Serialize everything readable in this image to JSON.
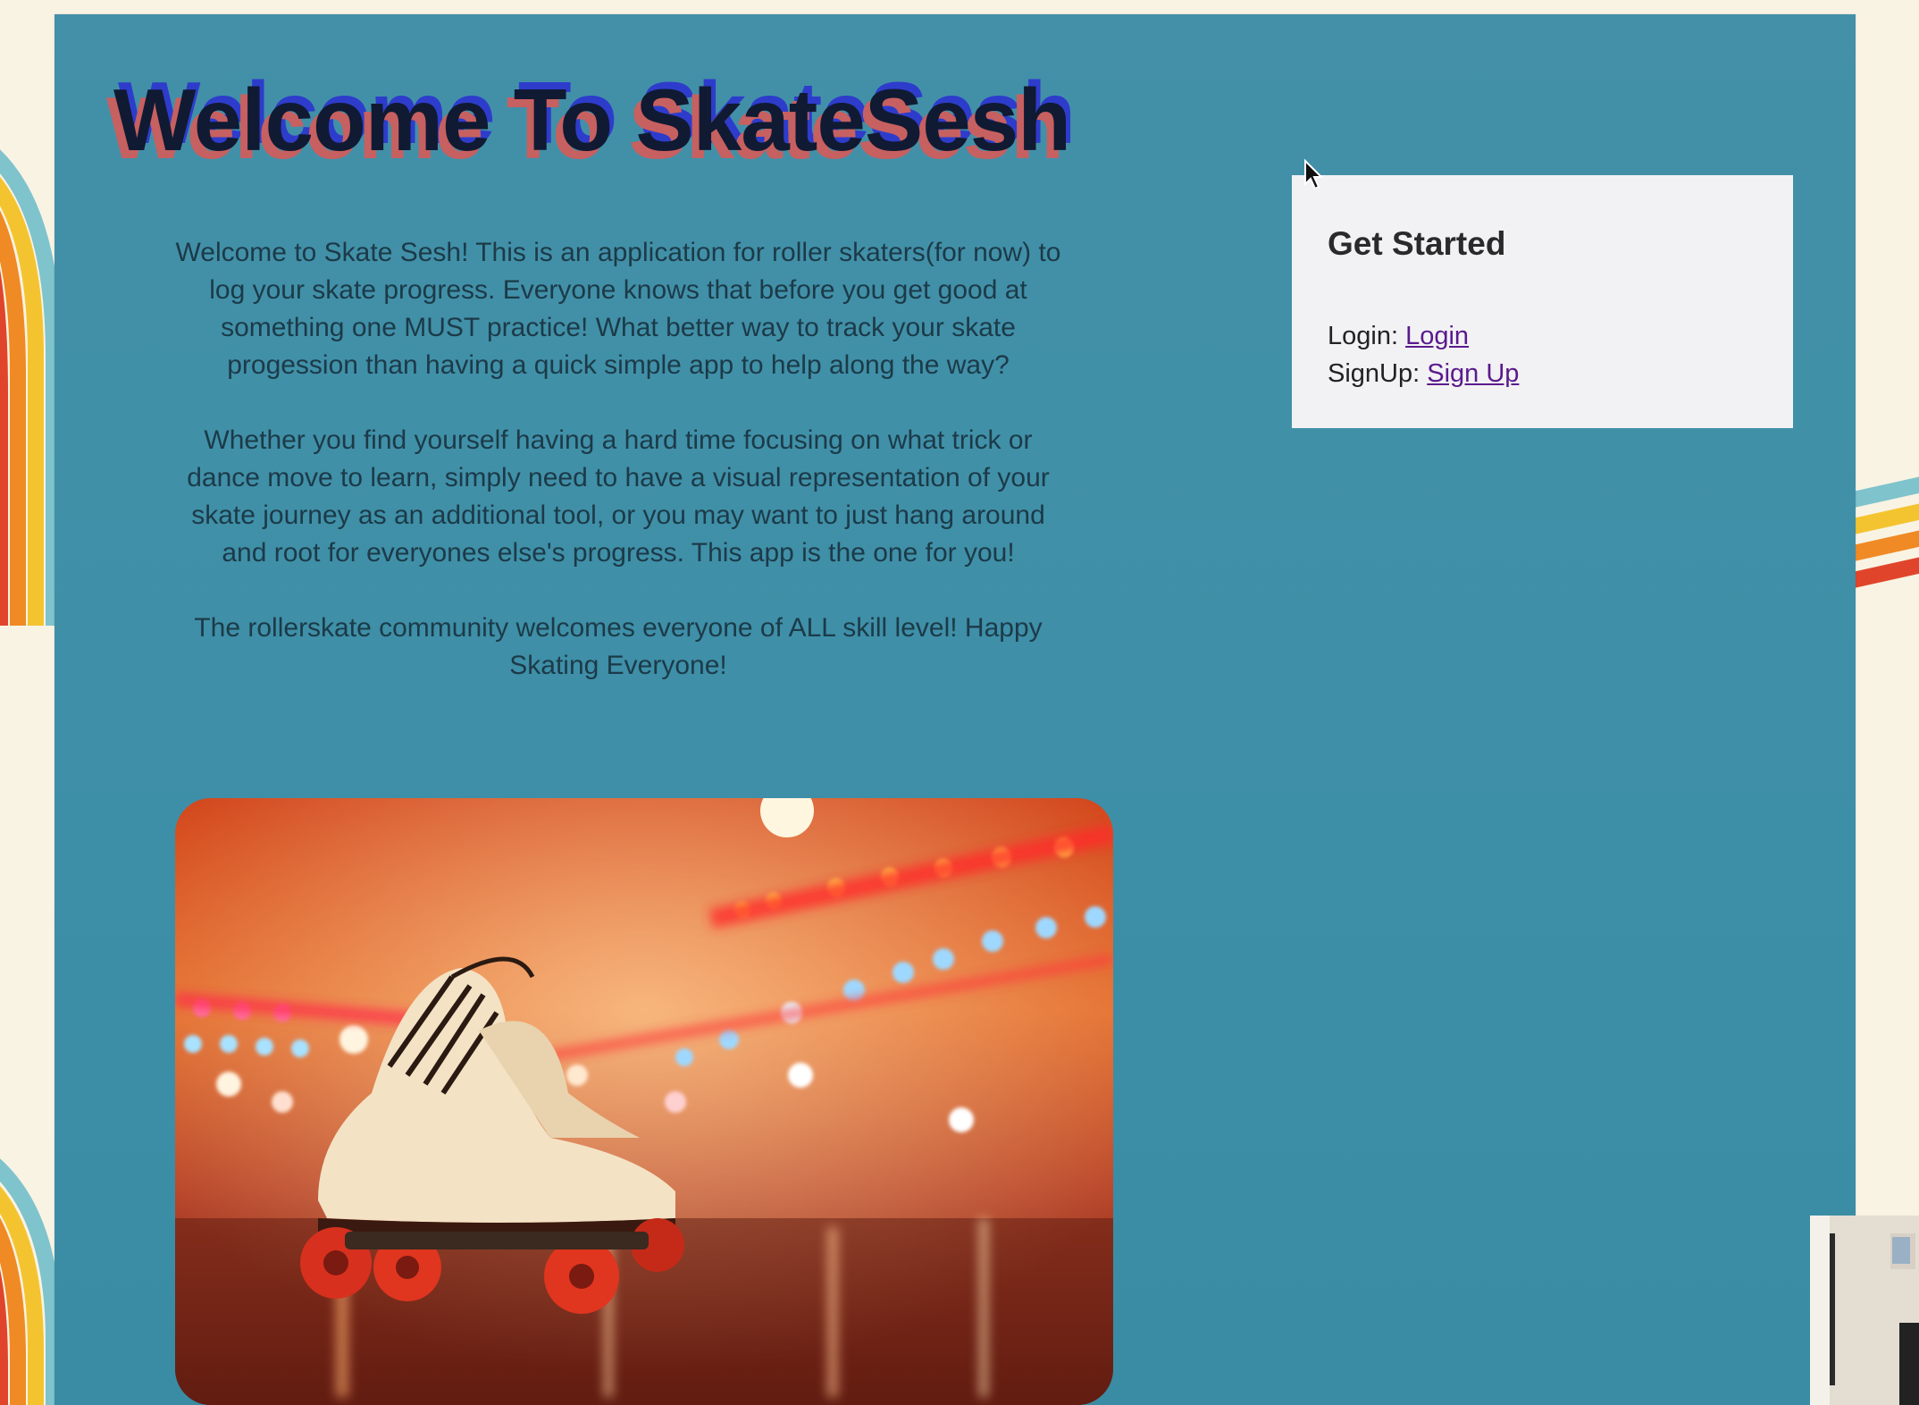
{
  "page": {
    "title": "Welcome To SkateSesh",
    "intro_paragraphs": [
      "Welcome to Skate Sesh! This is an application for roller skaters(for now) to log your skate progress. Everyone knows that before you get good at something one MUST practice! What better way to track your skate progession than having a quick simple app to help along the way?",
      "Whether you find yourself having a hard time focusing on what trick or dance move to learn, simply need to have a visual representation of your skate journey as an additional tool, or you may want to just hang around and root for everyones else's progress. This app is the one for you!",
      "The rollerskate community welcomes everyone of ALL skill level! Happy Skating Everyone!"
    ]
  },
  "sidebar": {
    "heading": "Get Started",
    "login_prefix": "Login: ",
    "login_link": "Login",
    "signup_prefix": "SignUp: ",
    "signup_link": "Sign Up"
  },
  "colors": {
    "panel": "#4190a8",
    "title_text": "#101a33",
    "title_shadow_red": "#c76060",
    "title_shadow_blue": "#2e3ccc",
    "body_text": "#1c3a48",
    "card_bg": "#f2f2f4",
    "link": "#5a1a8c",
    "page_bg": "#f9f3e4"
  },
  "icons": {
    "cursor": "mouse-pointer-icon"
  }
}
